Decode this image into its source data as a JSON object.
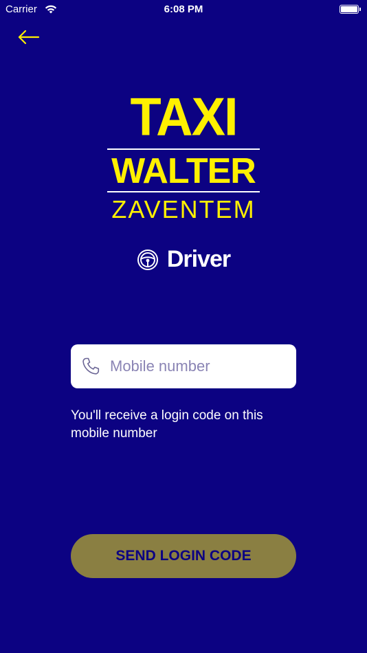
{
  "status_bar": {
    "carrier": "Carrier",
    "time": "6:08 PM",
    "battery_level": 1.0
  },
  "header": {
    "back_icon": "arrow-left-icon",
    "accent_color": "#fff000"
  },
  "logo": {
    "line1": "TAXI",
    "line2": "WALTER",
    "line3": "ZAVENTEM",
    "color": "#fff000"
  },
  "badge": {
    "icon": "steering-wheel-icon",
    "label": "Driver"
  },
  "login_form": {
    "mobile_field": {
      "icon": "phone-icon",
      "placeholder": "Mobile number",
      "value": ""
    },
    "helper_text": "You'll receive a login code on this mobile number",
    "submit_label": "SEND LOGIN CODE"
  },
  "theme": {
    "background": "#0c0282",
    "button_bg": "#8a7f42",
    "button_text": "#0c0282"
  }
}
